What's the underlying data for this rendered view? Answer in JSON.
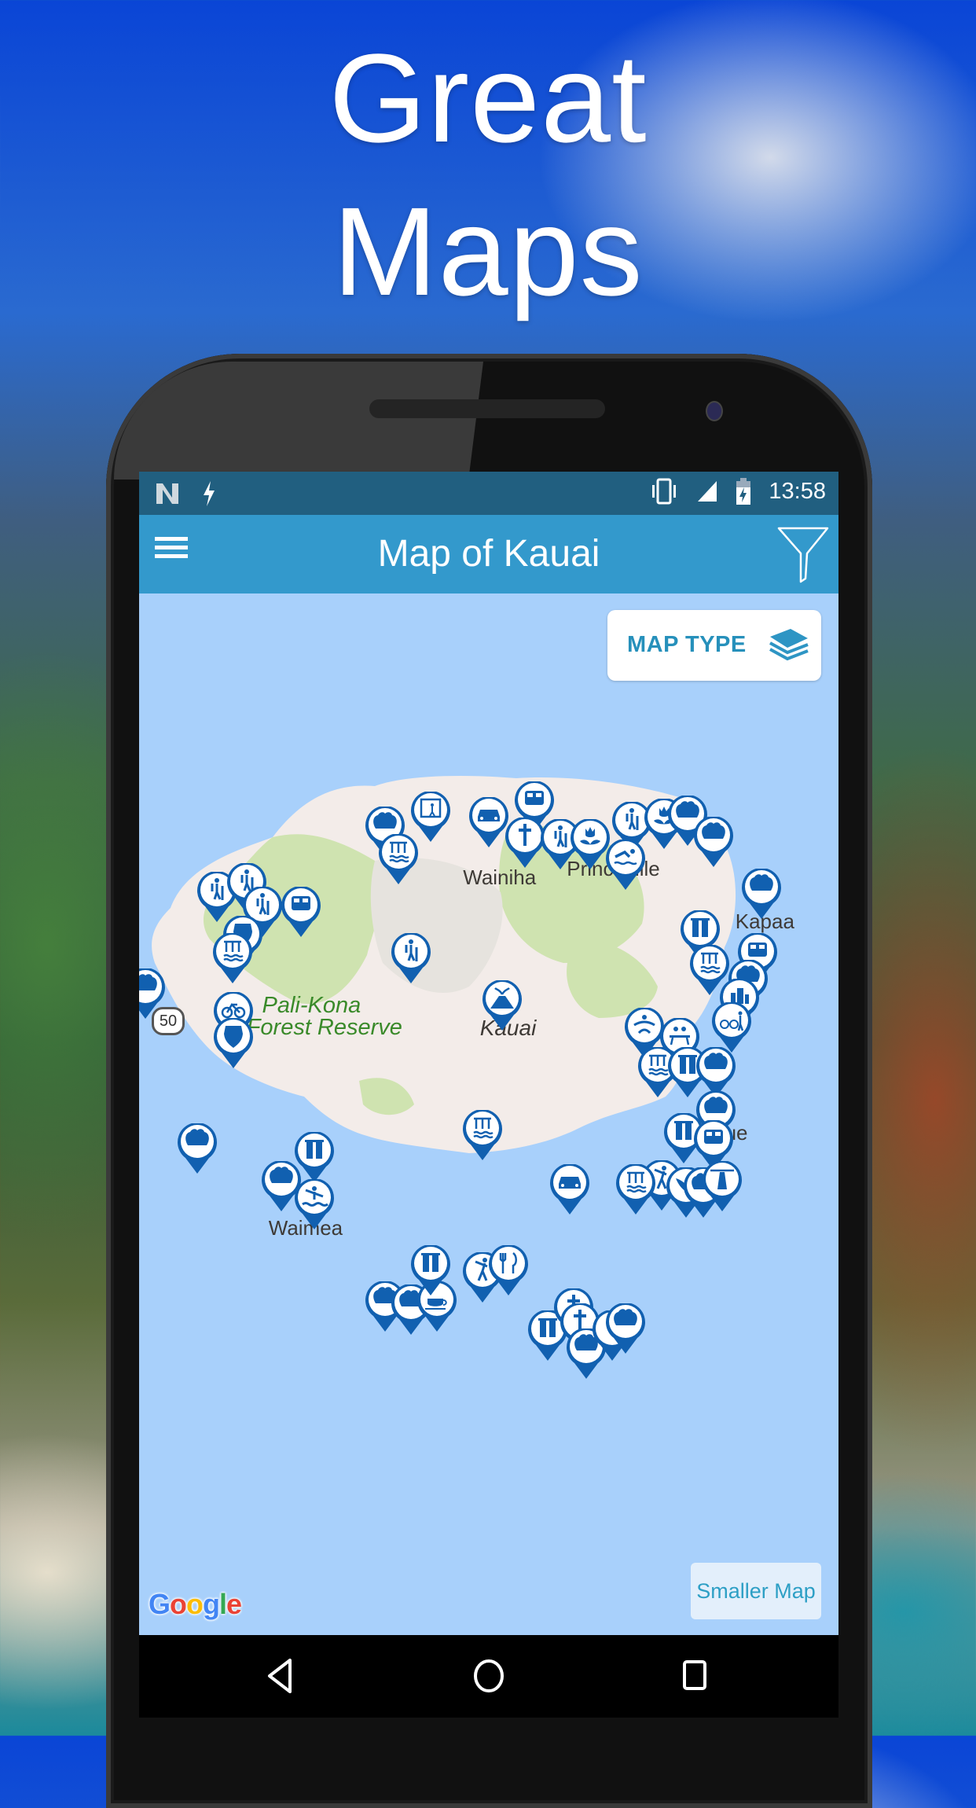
{
  "promo": {
    "headline_line1": "Great",
    "headline_line2": "Maps"
  },
  "status_bar": {
    "left_icons": [
      "notification-n-icon",
      "flash-icon"
    ],
    "right_icons": [
      "vibrate-icon",
      "cell-signal-icon",
      "battery-charging-icon"
    ],
    "time": "13:58"
  },
  "app_bar": {
    "title": "Map of Kauai",
    "menu_icon": "hamburger-menu-icon",
    "filter_icon": "funnel-filter-icon",
    "background": "#3399cc"
  },
  "map": {
    "map_type_button": {
      "label": "MAP TYPE",
      "icon": "layers-icon"
    },
    "smaller_map_button": {
      "label": "Smaller Map"
    },
    "attribution": "Google",
    "route_shield": "50",
    "place_labels": [
      {
        "name": "Wainiha",
        "style": "town",
        "lat": 22.2,
        "lon": -159.545
      },
      {
        "name": "Pali-Kona",
        "style": "park",
        "lat": 22.113,
        "lon": -159.7
      },
      {
        "name": "Forest Reserve",
        "style": "park",
        "lat": 22.098,
        "lon": -159.712
      },
      {
        "name": "Kauai",
        "style": "island",
        "lat": 22.097,
        "lon": -159.532
      },
      {
        "name": "Waimea",
        "style": "town",
        "lat": 21.96,
        "lon": -159.695
      },
      {
        "name": "Kapaa",
        "style": "town",
        "lat": 22.17,
        "lon": -159.335
      },
      {
        "name": "Princeville",
        "style": "town",
        "lat": 22.206,
        "lon": -159.465
      },
      {
        "name": "Lihue",
        "style": "town",
        "lat": 22.025,
        "lon": -159.364
      }
    ],
    "marker_color": "#1160b0",
    "markers": [
      {
        "type": "shell",
        "lat": 22.205,
        "lon": -159.605
      },
      {
        "type": "waterfall-hike",
        "lat": 22.215,
        "lon": -159.57
      },
      {
        "type": "waterfall",
        "lat": 22.186,
        "lon": -159.595
      },
      {
        "type": "car",
        "lat": 22.211,
        "lon": -159.525
      },
      {
        "type": "bus",
        "lat": 22.222,
        "lon": -159.49
      },
      {
        "type": "church",
        "lat": 22.197,
        "lon": -159.497
      },
      {
        "type": "hiker",
        "lat": 22.196,
        "lon": -159.47
      },
      {
        "type": "flower",
        "lat": 22.196,
        "lon": -159.447
      },
      {
        "type": "hiker",
        "lat": 22.208,
        "lon": -159.415
      },
      {
        "type": "swimmer",
        "lat": 22.182,
        "lon": -159.42
      },
      {
        "type": "flower",
        "lat": 22.21,
        "lon": -159.39
      },
      {
        "type": "shell",
        "lat": 22.212,
        "lon": -159.372
      },
      {
        "type": "shell",
        "lat": 22.198,
        "lon": -159.352
      },
      {
        "type": "hiker",
        "lat": 22.16,
        "lon": -159.735
      },
      {
        "type": "hiker",
        "lat": 22.166,
        "lon": -159.712
      },
      {
        "type": "bus",
        "lat": 22.15,
        "lon": -159.67
      },
      {
        "type": "hiker",
        "lat": 22.15,
        "lon": -159.7
      },
      {
        "type": "park",
        "lat": 22.13,
        "lon": -159.715
      },
      {
        "type": "waterfall",
        "lat": 22.118,
        "lon": -159.723
      },
      {
        "type": "hiker",
        "lat": 22.118,
        "lon": -159.585
      },
      {
        "type": "volcano",
        "lat": 22.086,
        "lon": -159.515
      },
      {
        "type": "shell",
        "lat": 22.094,
        "lon": -159.79
      },
      {
        "type": "bike",
        "lat": 22.078,
        "lon": -159.722
      },
      {
        "type": "park",
        "lat": 22.06,
        "lon": -159.722
      },
      {
        "type": "shell",
        "lat": 22.162,
        "lon": -159.315
      },
      {
        "type": "tower",
        "lat": 22.134,
        "lon": -159.362
      },
      {
        "type": "waterfall",
        "lat": 22.11,
        "lon": -159.355
      },
      {
        "type": "bus",
        "lat": 22.118,
        "lon": -159.318
      },
      {
        "type": "shell",
        "lat": 22.1,
        "lon": -159.325
      },
      {
        "type": "town",
        "lat": 22.087,
        "lon": -159.332
      },
      {
        "type": "bike-hiker",
        "lat": 22.071,
        "lon": -159.338
      },
      {
        "type": "yoga",
        "lat": 22.067,
        "lon": -159.405
      },
      {
        "type": "picnic",
        "lat": 22.06,
        "lon": -159.378
      },
      {
        "type": "waterfall",
        "lat": 22.04,
        "lon": -159.395
      },
      {
        "type": "tower",
        "lat": 22.04,
        "lon": -159.372
      },
      {
        "type": "shell",
        "lat": 22.04,
        "lon": -159.35
      },
      {
        "type": "shell",
        "lat": 22.01,
        "lon": -159.35
      },
      {
        "type": "tower",
        "lat": 21.995,
        "lon": -159.375
      },
      {
        "type": "bus",
        "lat": 21.99,
        "lon": -159.352
      },
      {
        "type": "golf",
        "lat": 21.963,
        "lon": -159.392
      },
      {
        "type": "eagle",
        "lat": 21.958,
        "lon": -159.373
      },
      {
        "type": "shell",
        "lat": 21.958,
        "lon": -159.36
      },
      {
        "type": "lighthouse",
        "lat": 21.962,
        "lon": -159.345
      },
      {
        "type": "waterfall",
        "lat": 21.96,
        "lon": -159.412
      },
      {
        "type": "car",
        "lat": 21.96,
        "lon": -159.463
      },
      {
        "type": "waterfall",
        "lat": 21.997,
        "lon": -159.53
      },
      {
        "type": "shell",
        "lat": 21.988,
        "lon": -159.75
      },
      {
        "type": "tower",
        "lat": 21.982,
        "lon": -159.66
      },
      {
        "type": "shell",
        "lat": 21.962,
        "lon": -159.685
      },
      {
        "type": "kayak",
        "lat": 21.95,
        "lon": -159.66
      },
      {
        "type": "shell",
        "lat": 21.88,
        "lon": -159.605
      },
      {
        "type": "shell",
        "lat": 21.878,
        "lon": -159.585
      },
      {
        "type": "coffee",
        "lat": 21.88,
        "lon": -159.565
      },
      {
        "type": "tower",
        "lat": 21.905,
        "lon": -159.57
      },
      {
        "type": "golf",
        "lat": 21.9,
        "lon": -159.53
      },
      {
        "type": "dining",
        "lat": 21.905,
        "lon": -159.51
      },
      {
        "type": "tower",
        "lat": 21.86,
        "lon": -159.48
      },
      {
        "type": "church",
        "lat": 21.875,
        "lon": -159.46
      },
      {
        "type": "church",
        "lat": 21.865,
        "lon": -159.455
      },
      {
        "type": "shell",
        "lat": 21.848,
        "lon": -159.45
      },
      {
        "type": "horse",
        "lat": 21.86,
        "lon": -159.43
      },
      {
        "type": "shell",
        "lat": 21.865,
        "lon": -159.42
      }
    ]
  },
  "nav_bar": {
    "back_icon": "back-triangle-icon",
    "home_icon": "home-circle-icon",
    "recents_icon": "recents-square-icon"
  }
}
